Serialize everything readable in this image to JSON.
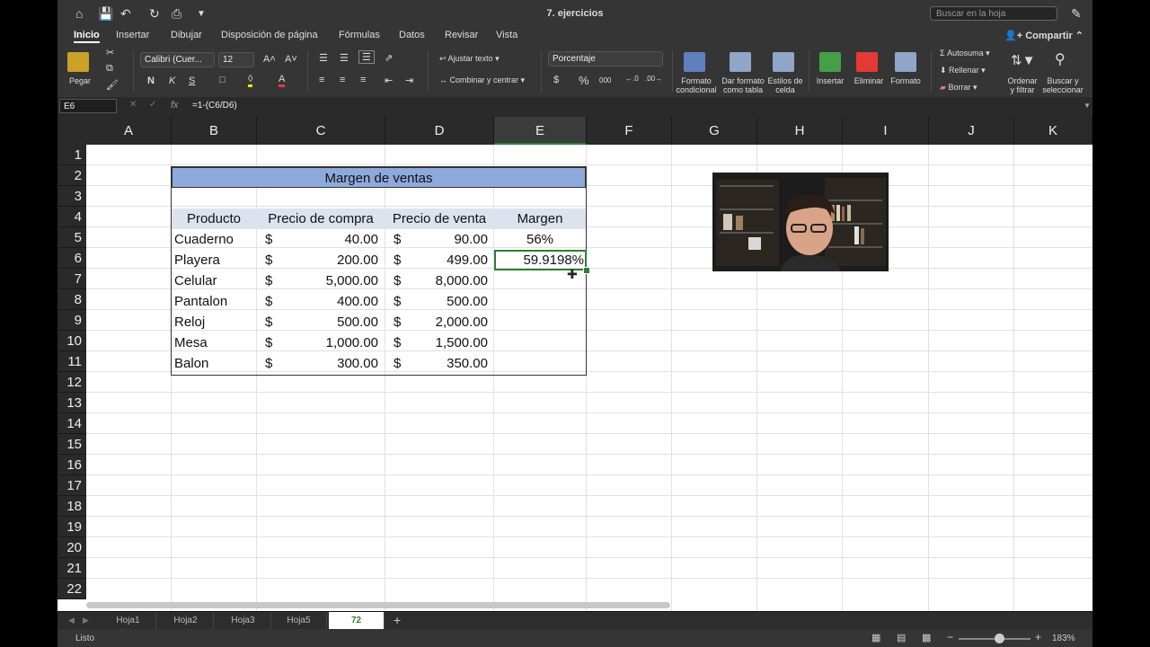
{
  "window": {
    "title": "7. ejercicios",
    "search_placeholder": "Buscar en la hoja"
  },
  "tabs": [
    "Inicio",
    "Insertar",
    "Dibujar",
    "Disposición de página",
    "Fórmulas",
    "Datos",
    "Revisar",
    "Vista"
  ],
  "share_label": "Compartir",
  "ribbon": {
    "paste": "Pegar",
    "font_name": "Calibri (Cuer...",
    "font_size": "12",
    "bold": "N",
    "italic": "K",
    "underline": "S",
    "wrap_text": "Ajustar texto",
    "merge_center": "Combinar y centrar",
    "number_format": "Porcentaje",
    "currency": "$",
    "percent": "%",
    "thousands": "000",
    "conditional_format": "Formato condicional",
    "format_as_table": "Dar formato como tabla",
    "cell_styles": "Estilos de celda",
    "insert": "Insertar",
    "delete": "Eliminar",
    "format": "Formato",
    "autosum": "Autosuma",
    "fill": "Rellenar",
    "clear": "Borrar",
    "sort_filter": "Ordenar y filtrar",
    "find_select": "Buscar y seleccionar"
  },
  "formula_bar": {
    "name_box": "E6",
    "fx": "fx",
    "formula": "=1-(C6/D6)"
  },
  "columns": [
    "A",
    "B",
    "C",
    "D",
    "E",
    "F",
    "G",
    "H",
    "I",
    "J",
    "K"
  ],
  "rows": [
    "1",
    "2",
    "3",
    "4",
    "5",
    "6",
    "7",
    "8",
    "9",
    "10",
    "11",
    "12",
    "13",
    "14",
    "15",
    "16",
    "17",
    "18",
    "19",
    "20",
    "21",
    "22"
  ],
  "table": {
    "title": "Margen de ventas",
    "headers": [
      "Producto",
      "Precio de compra",
      "Precio de venta",
      "Margen"
    ],
    "rows": [
      {
        "producto": "Cuaderno",
        "compra": "40.00",
        "venta": "90.00",
        "margen": "56%"
      },
      {
        "producto": "Playera",
        "compra": "200.00",
        "venta": "499.00",
        "margen": "59.9198%"
      },
      {
        "producto": "Celular",
        "compra": "5,000.00",
        "venta": "8,000.00",
        "margen": ""
      },
      {
        "producto": "Pantalon",
        "compra": "400.00",
        "venta": "500.00",
        "margen": ""
      },
      {
        "producto": "Reloj",
        "compra": "500.00",
        "venta": "2,000.00",
        "margen": ""
      },
      {
        "producto": "Mesa",
        "compra": "1,000.00",
        "venta": "1,500.00",
        "margen": ""
      },
      {
        "producto": "Balon",
        "compra": "300.00",
        "venta": "350.00",
        "margen": ""
      }
    ],
    "currency_symbol": "$"
  },
  "sheets": [
    "Hoja1",
    "Hoja2",
    "Hoja3",
    "Hoja5",
    "72"
  ],
  "active_sheet": "72",
  "status": {
    "ready": "Listo",
    "zoom": "183%"
  },
  "colors": {
    "accent": "#2e7d32",
    "title_band": "#8ea9db",
    "header_band": "#dde3ee"
  }
}
